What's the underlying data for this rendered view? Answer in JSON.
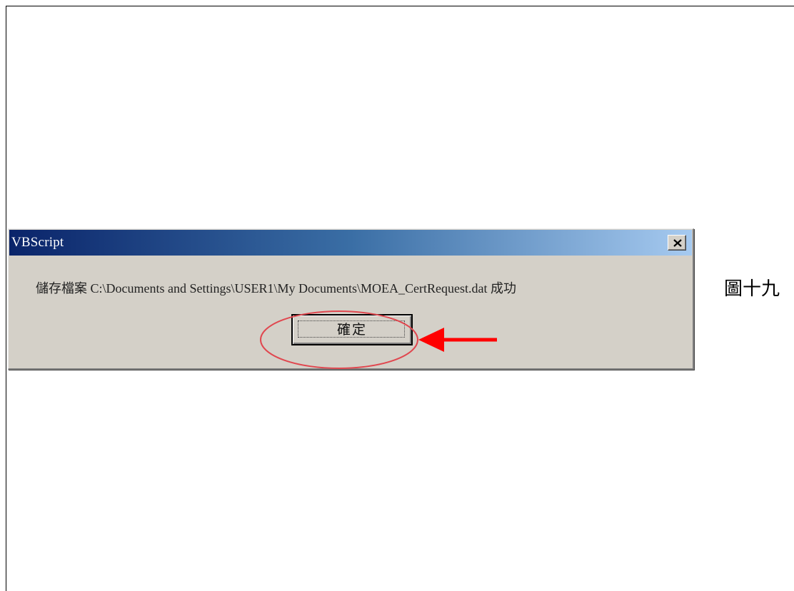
{
  "dialog": {
    "title": "VBScript",
    "message": "儲存檔案 C:\\Documents and Settings\\USER1\\My Documents\\MOEA_CertRequest.dat 成功",
    "ok_label": "確定",
    "close_icon": "close-icon"
  },
  "figure": {
    "label": "圖十九"
  },
  "annotations": {
    "highlight_color": "#e0474f",
    "arrow_color": "#ff0000"
  },
  "colors": {
    "titlebar_start": "#0a246a",
    "titlebar_end": "#a6caf0",
    "dialog_bg": "#d4d0c8"
  }
}
